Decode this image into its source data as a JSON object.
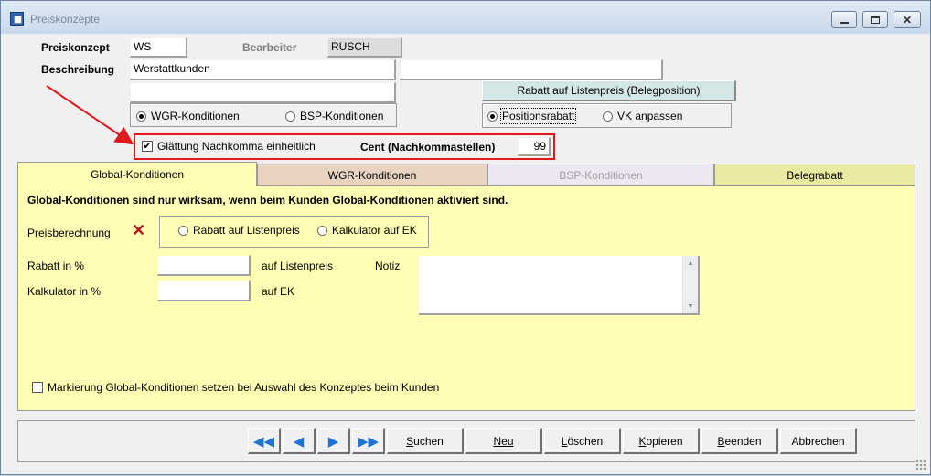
{
  "window": {
    "title": "Preiskonzepte"
  },
  "header": {
    "preiskonzept_label": "Preiskonzept",
    "preiskonzept_value": "WS",
    "bearbeiter_label": "Bearbeiter",
    "bearbeiter_value": "RUSCH",
    "beschreibung_label": "Beschreibung",
    "beschreibung_value": "Werstattkunden",
    "rabatt_listenpreis_button": "Rabatt auf Listenpreis (Belegposition)"
  },
  "konditionen_radio": {
    "wgr": "WGR-Konditionen",
    "bsp": "BSP-Konditionen",
    "selected": "wgr"
  },
  "rabatt_radio": {
    "positionsrabatt": "Positionsrabatt",
    "vk_anpassen": "VK anpassen",
    "selected": "positionsrabatt"
  },
  "glaettung": {
    "label": "Glättung Nachkomma einheitlich",
    "checked": true,
    "cent_label": "Cent (Nachkommastellen)",
    "cent_value": "99"
  },
  "tabs": [
    {
      "label": "Global-Konditionen",
      "color": "#fffdb3",
      "text_color": "#000000",
      "active": true
    },
    {
      "label": "WGR-Konditionen",
      "color": "#e8d4c0",
      "text_color": "#000000",
      "active": false
    },
    {
      "label": "BSP-Konditionen",
      "color": "#ece7f0",
      "text_color": "#a0a0a0",
      "active": false
    },
    {
      "label": "Belegrabatt",
      "color": "#eaeaa2",
      "text_color": "#000000",
      "active": false
    }
  ],
  "global_panel": {
    "info_text": "Global-Konditionen sind nur wirksam, wenn beim Kunden Global-Konditionen aktiviert sind.",
    "preisberechnung_label": "Preisberechnung",
    "preisberechnung_icon": "red-x-icon",
    "radio_listenpreis": "Rabatt auf Listenpreis",
    "radio_kalkulator": "Kalkulator auf EK",
    "rabatt_label": "Rabatt in %",
    "rabatt_value": "",
    "rabatt_suffix": "auf Listenpreis",
    "kalkulator_label": "Kalkulator in %",
    "kalkulator_value": "",
    "kalkulator_suffix": "auf EK",
    "notiz_label": "Notiz",
    "notiz_value": "",
    "markierung_label": "Markierung Global-Konditionen setzen bei Auswahl des Konzeptes beim Kunden",
    "markierung_checked": false
  },
  "buttons": {
    "nav_first": "first-record-icon",
    "nav_prev": "previous-record-icon",
    "nav_next": "next-record-icon",
    "nav_last": "last-record-icon",
    "suchen_u": "S",
    "suchen_rest": "uchen",
    "neu_u": "N",
    "neu_rest": "eu",
    "loeschen_u": "L",
    "loeschen_rest": "öschen",
    "kopieren_u": "K",
    "kopieren_rest": "opieren",
    "beenden_u": "B",
    "beenden_rest": "eenden",
    "abbrechen": "Abbrechen"
  }
}
